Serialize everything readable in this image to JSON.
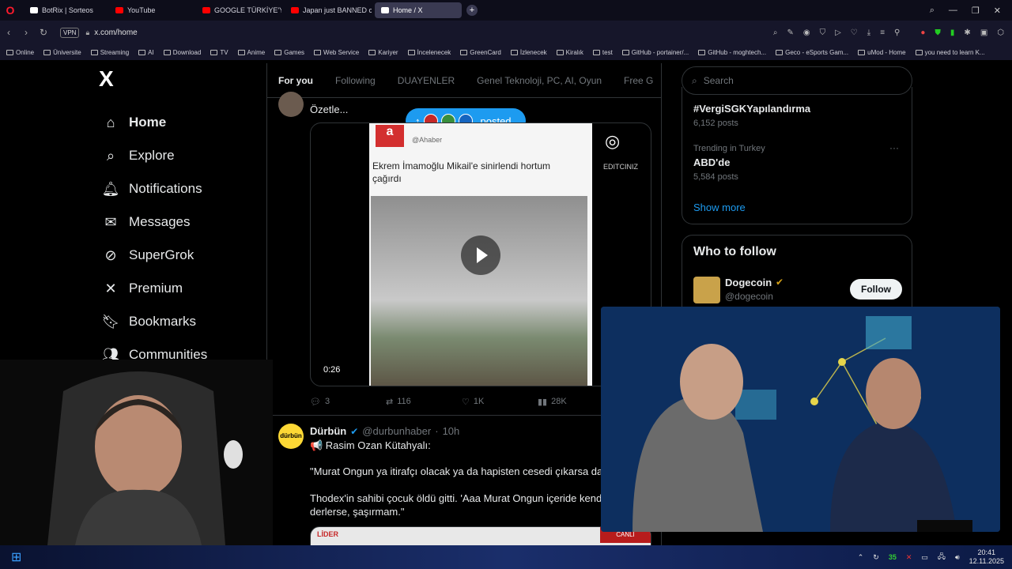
{
  "browser": {
    "tabs": [
      {
        "label": "BotRix | Sorteos",
        "icon_color": "#ffffff"
      },
      {
        "label": "YouTube",
        "icon_color": "#ff0000"
      },
      {
        "label": "GOOGLE TÜRKİYE'YE",
        "icon_color": "#ff0000"
      },
      {
        "label": "Japan just BANNED censo",
        "icon_color": "#ff0000"
      },
      {
        "label": "Home / X",
        "icon_color": "#ffffff"
      }
    ],
    "new_tab": "+",
    "vpn_label": "VPN",
    "url": "x.com/home"
  },
  "bookmarks": [
    "Online",
    "Üniversite",
    "Streaming",
    "AI",
    "Download",
    "TV",
    "Anime",
    "Games",
    "Web Service",
    "Kariyer",
    "İncelenecek",
    "GreenCard",
    "İzlenecek",
    "Kiralık",
    "test",
    "GitHub - portainer/...",
    "GitHub - moghtech...",
    "Geco - eSports Gam...",
    "uMod - Home",
    "you need to learn K..."
  ],
  "sidebar": {
    "logo": "X",
    "items": [
      {
        "label": "Home",
        "icon": "home-icon",
        "glyph": "⌂"
      },
      {
        "label": "Explore",
        "icon": "search-icon",
        "glyph": "⌕"
      },
      {
        "label": "Notifications",
        "icon": "bell-icon",
        "glyph": "🔔︎"
      },
      {
        "label": "Messages",
        "icon": "envelope-icon",
        "glyph": "✉"
      },
      {
        "label": "SuperGrok",
        "icon": "grok-icon",
        "glyph": "⊘"
      },
      {
        "label": "Premium",
        "icon": "x-premium-icon",
        "glyph": "✕"
      },
      {
        "label": "Bookmarks",
        "icon": "bookmark-icon",
        "glyph": "🔖︎"
      },
      {
        "label": "Communities",
        "icon": "communities-icon",
        "glyph": "👥︎"
      }
    ]
  },
  "timeline": {
    "tabs": [
      "For you",
      "Following",
      "DUAYENLER",
      "Genel Teknoloji, PC, AI, Oyun",
      "Free G"
    ],
    "posted_label": "posted",
    "tweet1": {
      "text": "Özetle...",
      "video_source": "@Ahaber",
      "video_headline": "Ekrem İmamoğlu Mikail'e sinirlendi hortum çağırdı",
      "video_overlay": "EDITCINIZ",
      "duration": "0:26",
      "stats": {
        "replies": "3",
        "reposts": "116",
        "likes": "1K",
        "views": "28K"
      }
    },
    "tweet2": {
      "name": "Dürbün",
      "handle": "@durbunhaber",
      "time": "10h",
      "line1": "📢 Rasim Ozan Kütahyalı:",
      "line2": "\"Murat Ongun ya itirafçı olacak ya da hapisten cesedi çıkarsa da s",
      "line3": "Thodex'in sahibi çocuk öldü gitti. 'Aaa Murat Ongun içeride kendi",
      "line4": "derlerse, şaşırmam.\"",
      "preview_left": "LİDER",
      "preview_right": "CANLI"
    }
  },
  "right": {
    "search_placeholder": "Search",
    "trend1": {
      "title": "#VergiSGKYapılandırma",
      "posts": "6,152 posts"
    },
    "trend2": {
      "context": "Trending in Turkey",
      "title": "ABD'de",
      "posts": "5,584 posts"
    },
    "show_more": "Show more",
    "who_title": "Who to follow",
    "suggest": {
      "name": "Dogecoin",
      "handle": "@dogecoin",
      "follow": "Follow"
    }
  },
  "taskbar": {
    "badge_count": "35",
    "time": "20:41",
    "date": "12.11.2025"
  },
  "colors": {
    "accent": "#1d9bf0",
    "bg": "#000000",
    "border": "#2f3336",
    "muted": "#71767b"
  }
}
